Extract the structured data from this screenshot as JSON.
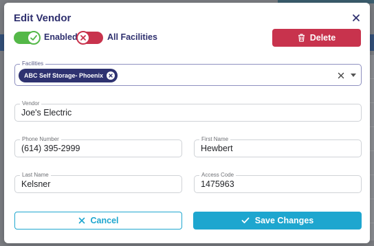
{
  "dialog": {
    "title": "Edit Vendor"
  },
  "toggles": {
    "enabled": {
      "label": "Enabled",
      "on": true,
      "color": "#54b848"
    },
    "all_facilities": {
      "label": "All Facilities",
      "on": false,
      "color": "#c8334d"
    }
  },
  "actions": {
    "delete_label": "Delete",
    "cancel_label": "Cancel",
    "save_label": "Save Changes"
  },
  "fields": {
    "facilities": {
      "label": "Facilities",
      "chips": [
        "ABC Self Storage- Phoenix"
      ]
    },
    "vendor": {
      "label": "Vendor",
      "value": "Joe's Electric"
    },
    "phone": {
      "label": "Phone Number",
      "value": "(614) 395-2999"
    },
    "first_name": {
      "label": "First Name",
      "value": "Hewbert"
    },
    "last_name": {
      "label": "Last Name",
      "value": "Kelsner"
    },
    "access_code": {
      "label": "Access Code",
      "value": "1475963"
    }
  },
  "icons": {
    "close": "close-icon",
    "check": "check-icon",
    "x": "x-icon",
    "trash": "trash-icon",
    "chip_remove": "remove-chip-icon",
    "clear": "clear-icon",
    "dropdown": "chevron-down-icon"
  },
  "colors": {
    "primary_navy": "#2e2f6e",
    "danger": "#c8334d",
    "success": "#54b848",
    "accent_teal": "#1ea6cf"
  }
}
